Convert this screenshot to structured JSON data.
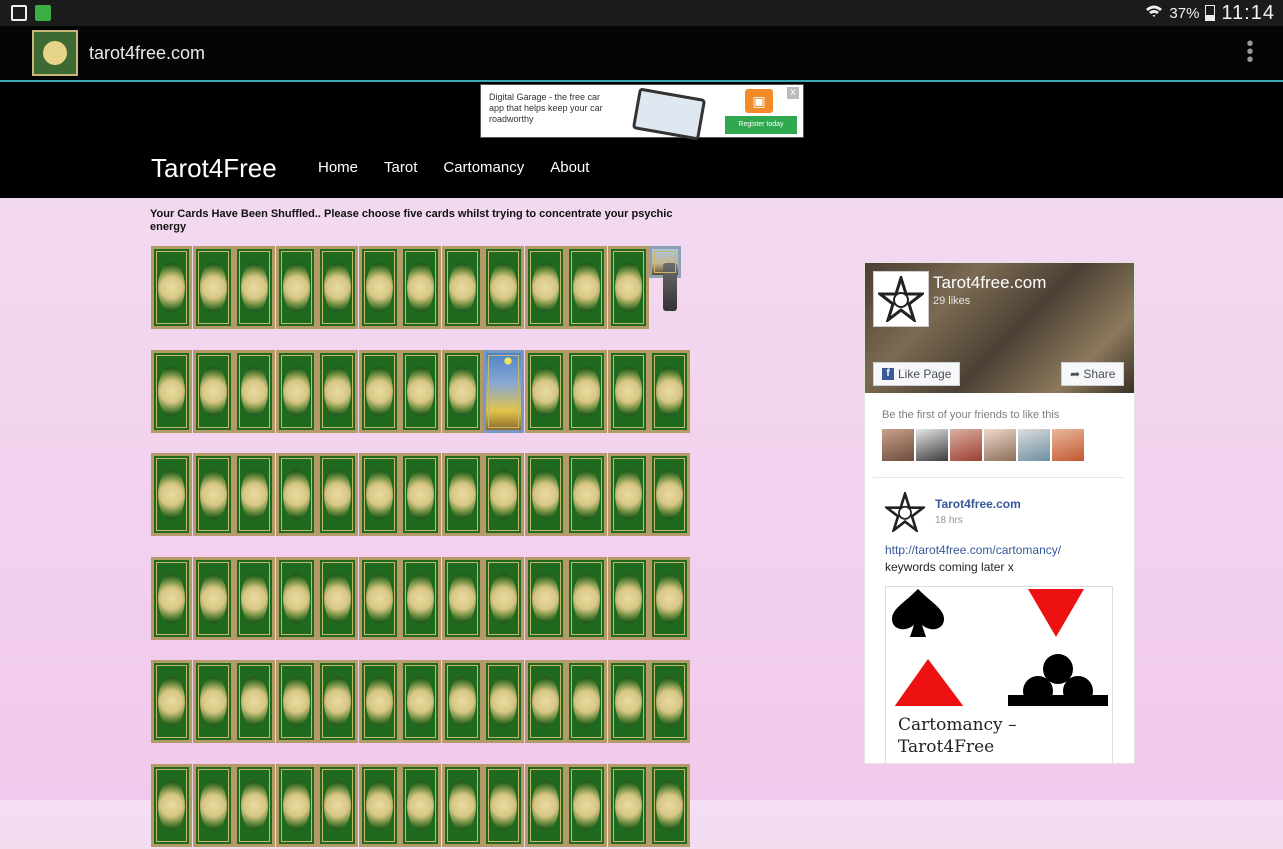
{
  "status_bar": {
    "battery": "37%",
    "time": "11:14"
  },
  "browser": {
    "url": "tarot4free.com"
  },
  "ad": {
    "text": "Digital Garage - the free car app that helps keep your car roadworthy",
    "button": "Register today",
    "close": "x"
  },
  "site": {
    "title": "Tarot4Free",
    "nav": [
      "Home",
      "Tarot",
      "Cartomancy",
      "About"
    ]
  },
  "instructions": "Your Cards Have Been Shuffled.. Please choose five cards whilst trying to concentrate your psychic energy",
  "card_grid": {
    "rows": [
      {
        "count": 13,
        "face_up_index": 12
      },
      {
        "count": 13,
        "face_up_index": 8
      },
      {
        "count": 13
      },
      {
        "count": 13
      },
      {
        "count": 13
      },
      {
        "count": 13
      }
    ]
  },
  "facebook": {
    "page_name": "Tarot4free.com",
    "likes": "29 likes",
    "like_button": "Like Page",
    "share_button": "Share",
    "friends_text": "Be the first of your friends to like this",
    "post": {
      "author": "Tarot4free.com",
      "time": "18 hrs",
      "link": "http://tarot4free.com/cartomancy/",
      "text": "keywords coming later x",
      "caption": "Cartomancy – Tarot4Free"
    }
  }
}
